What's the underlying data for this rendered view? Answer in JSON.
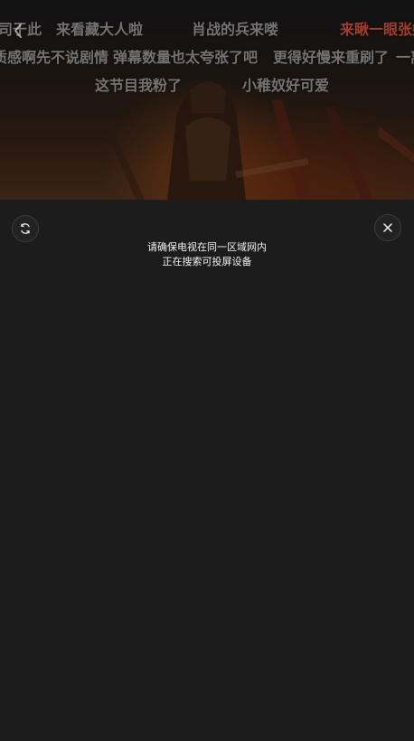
{
  "danmaku": {
    "row1": [
      "司于此",
      "来看藏大人啦",
      "肖战的兵来喽",
      "来瞅一眼张婧"
    ],
    "row2": [
      "质感啊先不说剧情",
      "弹幕数量也太夸张了吧",
      "更得好慢来重刷了",
      "一离"
    ],
    "row3": [
      "这节目我粉了",
      "小稚奴好可爱"
    ]
  },
  "colors": {
    "panel_bg": "#1c1c1c",
    "danmaku_gray": "rgba(200,200,200,0.55)",
    "danmaku_red": "rgba(190,70,50,0.85)"
  },
  "cast": {
    "message_line1": "请确保电视在同一区域网内",
    "message_line2": "正在搜索可投屏设备"
  },
  "icons": {
    "back": "chevron-left-icon",
    "refresh": "refresh-icon",
    "close": "close-icon"
  }
}
